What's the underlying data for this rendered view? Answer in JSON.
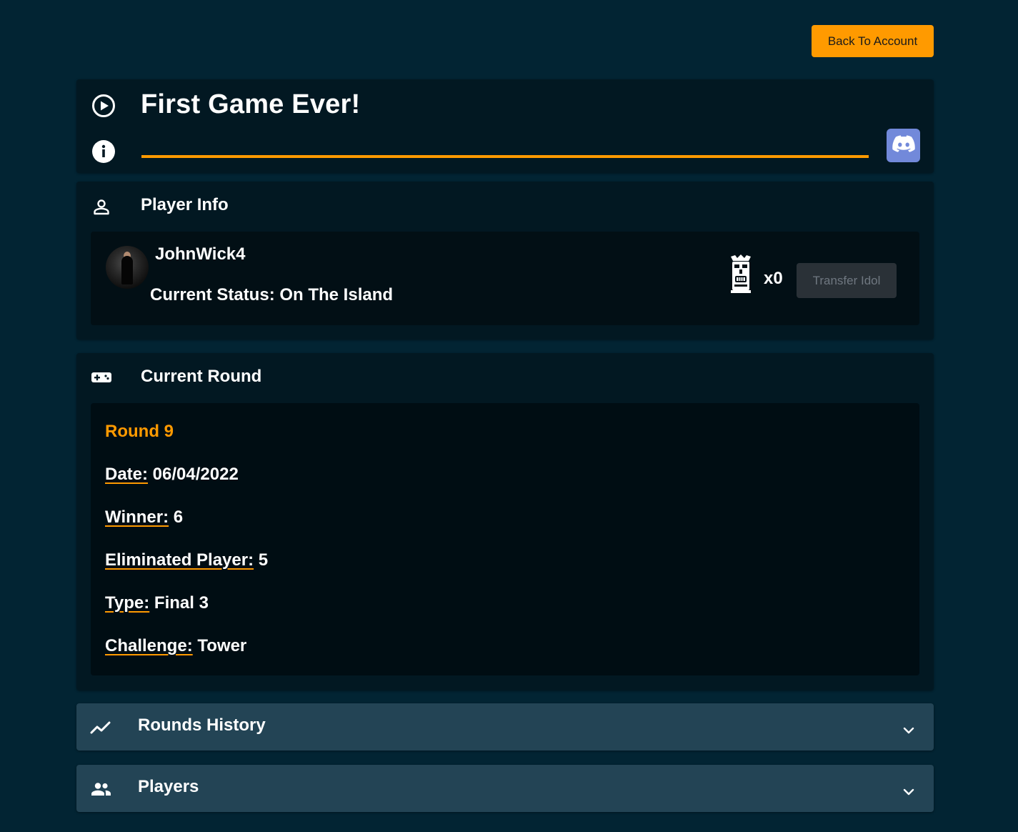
{
  "header": {
    "back_label": "Back To Account"
  },
  "game": {
    "title": "First Game Ever!"
  },
  "player_info": {
    "title": "Player Info",
    "name": "JohnWick4",
    "status": "Current Status: On The Island",
    "idol_count": "x0",
    "transfer_label": "Transfer Idol"
  },
  "current_round": {
    "title": "Current Round",
    "round_name": "Round 9",
    "date_label": "Date:",
    "date_value": " 06/04/2022",
    "winner_label": "Winner:",
    "winner_value": " 6",
    "eliminated_label": "Eliminated Player:",
    "eliminated_value": " 5",
    "type_label": "Type:",
    "type_value": " Final 3",
    "challenge_label": "Challenge:",
    "challenge_value": " Tower"
  },
  "rounds_history": {
    "title": "Rounds History"
  },
  "players": {
    "title": "Players"
  },
  "colors": {
    "accent": "#ff9a00",
    "discord": "#7289da",
    "background": "#022433"
  }
}
